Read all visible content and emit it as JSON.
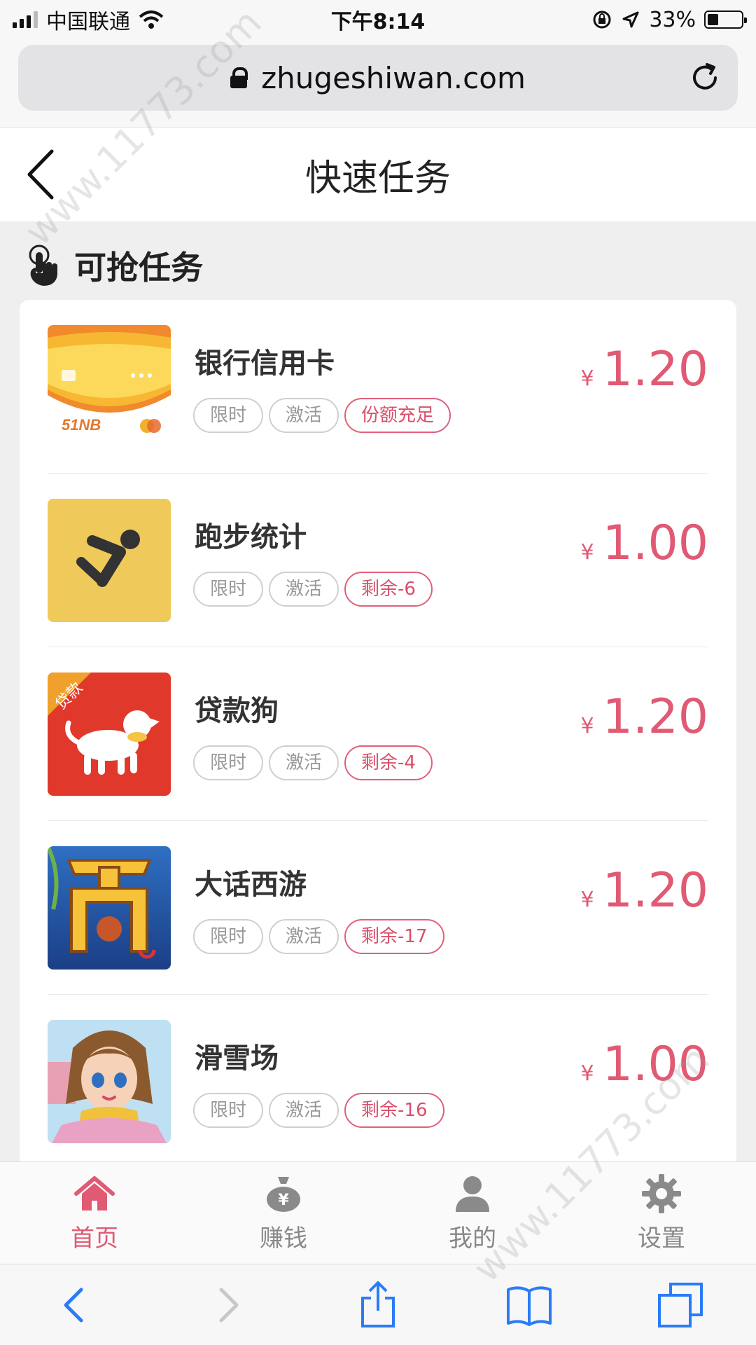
{
  "status_bar": {
    "carrier": "中国联通",
    "time": "下午8:14",
    "battery": "33%",
    "battery_level": 0.33
  },
  "browser": {
    "url": "zhugeshiwan.com"
  },
  "header": {
    "title": "快速任务"
  },
  "section": {
    "title": "可抢任务"
  },
  "tasks": [
    {
      "name": "银行信用卡",
      "tags": [
        "限时",
        "激活"
      ],
      "hot_tag": "份额充足",
      "currency": "¥",
      "price": "1.20",
      "icon": "credit-card-app-icon"
    },
    {
      "name": "跑步统计",
      "tags": [
        "限时",
        "激活"
      ],
      "hot_tag": "剩余-6",
      "currency": "¥",
      "price": "1.00",
      "icon": "running-app-icon"
    },
    {
      "name": "贷款狗",
      "tags": [
        "限时",
        "激活"
      ],
      "hot_tag": "剩余-4",
      "currency": "¥",
      "price": "1.20",
      "icon": "loan-dog-app-icon"
    },
    {
      "name": "大话西游",
      "tags": [
        "限时",
        "激活"
      ],
      "hot_tag": "剩余-17",
      "currency": "¥",
      "price": "1.20",
      "icon": "westward-journey-game-icon"
    },
    {
      "name": "滑雪场",
      "tags": [
        "限时",
        "激活"
      ],
      "hot_tag": "剩余-16",
      "currency": "¥",
      "price": "1.00",
      "icon": "ski-resort-game-icon"
    }
  ],
  "tabbar": {
    "items": [
      {
        "label": "首页",
        "icon": "home-icon",
        "active": true
      },
      {
        "label": "赚钱",
        "icon": "money-bag-icon",
        "active": false
      },
      {
        "label": "我的",
        "icon": "user-icon",
        "active": false
      },
      {
        "label": "设置",
        "icon": "gear-icon",
        "active": false
      }
    ]
  },
  "watermark": "www.11773.com",
  "colors": {
    "accent": "#e05a74",
    "inactive": "#888888",
    "safari_blue": "#2a7cf6"
  }
}
